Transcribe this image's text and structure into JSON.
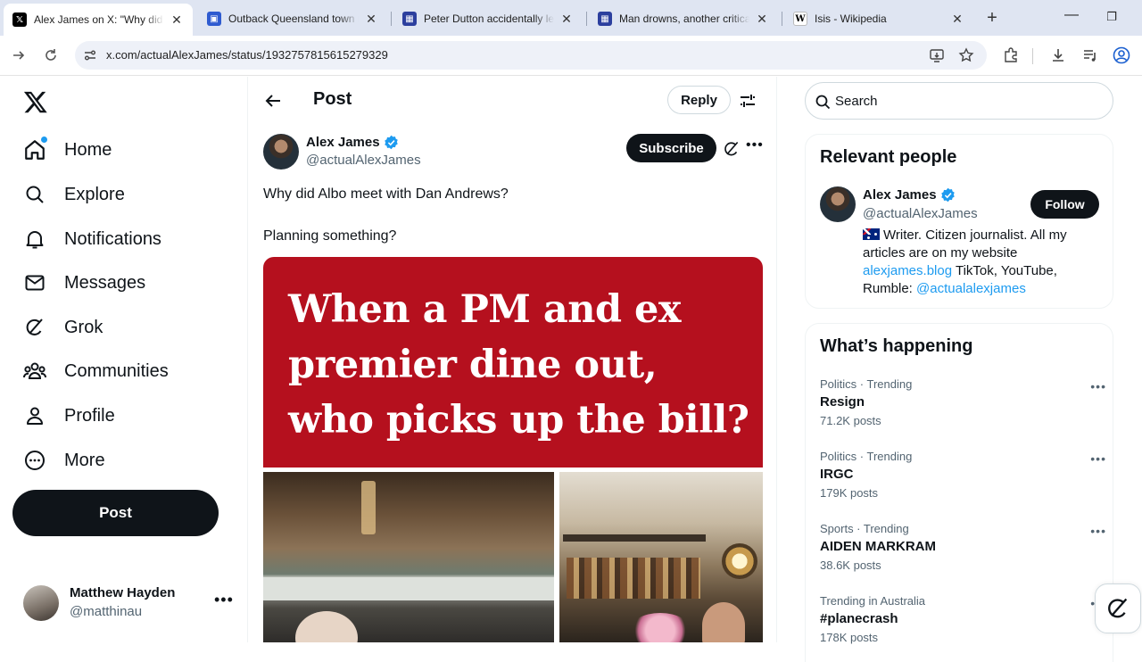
{
  "browser": {
    "tabs": [
      {
        "title": "Alex James on X: \"Why did Albo meet with Dan Andrews?\"",
        "icon": "x-favicon",
        "active": true
      },
      {
        "title": "Outback Queensland town ravaged by floods",
        "icon": "news-favicon",
        "active": false
      },
      {
        "title": "Peter Dutton accidentally leaves",
        "icon": "news-favicon",
        "active": false
      },
      {
        "title": "Man drowns, another critical",
        "icon": "news-favicon",
        "active": false
      },
      {
        "title": "Isis - Wikipedia",
        "icon": "wikipedia-favicon",
        "active": false
      }
    ],
    "url": "x.com/actualAlexJames/status/1932757815615279329"
  },
  "nav": {
    "items": [
      {
        "label": "Home",
        "icon": "home-icon"
      },
      {
        "label": "Explore",
        "icon": "search-icon"
      },
      {
        "label": "Notifications",
        "icon": "bell-icon"
      },
      {
        "label": "Messages",
        "icon": "envelope-icon"
      },
      {
        "label": "Grok",
        "icon": "grok-icon"
      },
      {
        "label": "Communities",
        "icon": "people-icon"
      },
      {
        "label": "Profile",
        "icon": "person-icon"
      },
      {
        "label": "More",
        "icon": "more-circle-icon"
      }
    ],
    "post_label": "Post",
    "account": {
      "name": "Matthew Hayden",
      "handle": "@matthinau"
    }
  },
  "main": {
    "header_title": "Post",
    "reply_label": "Reply",
    "author": {
      "name": "Alex James",
      "handle": "@actualAlexJames"
    },
    "subscribe_label": "Subscribe",
    "text_line1": "Why did Albo meet with Dan Andrews?",
    "text_line2": "Planning something?",
    "media_headline": "When a PM and ex premier dine out, who picks up the bill?"
  },
  "sidebar": {
    "search_placeholder": "Search",
    "relevant": {
      "title": "Relevant people",
      "name": "Alex James",
      "handle": "@actualAlexJames",
      "follow_label": "Follow",
      "bio_text": "Writer. Citizen journalist. All my articles are on my website",
      "bio_link": "alexjames.blog",
      "bio_text2": "TikTok, YouTube, Rumble:",
      "bio_mention": "@actualalexjames"
    },
    "happening": {
      "title": "What’s happening",
      "trends": [
        {
          "category": "Politics · Trending",
          "topic": "Resign",
          "count": "71.2K posts"
        },
        {
          "category": "Politics · Trending",
          "topic": "IRGC",
          "count": "179K posts"
        },
        {
          "category": "Sports · Trending",
          "topic": "AIDEN MARKRAM",
          "count": "38.6K posts"
        },
        {
          "category": "Trending in Australia",
          "topic": "#planecrash",
          "count": "178K posts"
        }
      ]
    }
  },
  "colors": {
    "accent": "#1d9bf0",
    "banner": "#b5101e",
    "button": "#0f1419"
  }
}
